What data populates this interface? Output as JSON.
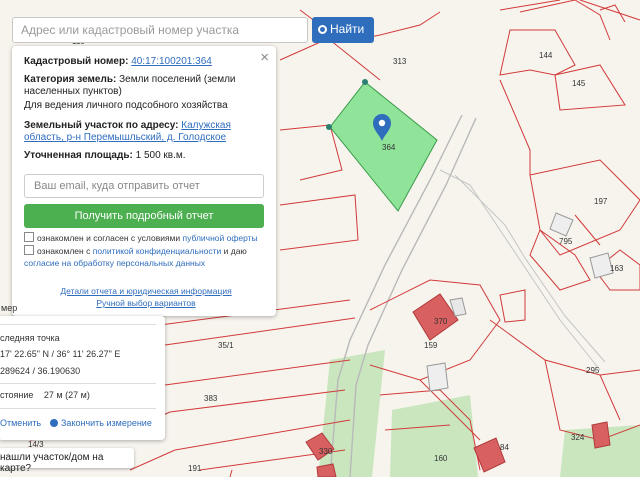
{
  "search": {
    "placeholder": "Адрес или кадастровый номер участка",
    "button_label": "Найти"
  },
  "panel": {
    "cad_label": "Кадастровый номер:",
    "cad_value": "40:17:100201:364",
    "category_label": "Категория земель:",
    "category_value": "Земли поселений (земли населенных пунктов)",
    "usage": "Для ведения личного подсобного хозяйства",
    "address_label": "Земельный участок по адресу:",
    "address_value": "Калужская область, р-н Перемышльский, д. Голодское",
    "area_label": "Уточненная площадь:",
    "area_value": "1 500 кв.м.",
    "email_placeholder": "Ваш email, куда отправить отчет",
    "get_report": "Получить подробный отчет",
    "consent1_prefix": "ознакомлен и согласен с условиями",
    "consent1_link": "публичной оферты",
    "consent2_prefix": "ознакомлен с",
    "consent2_link": "политикой конфиденциальности",
    "consent2_mid": "и даю",
    "consent2_link2": "согласие на обработку персональных данных",
    "details_link": "Детали отчета и юридическая информация",
    "manual_link": "Ручной выбор вариантов"
  },
  "measure": {
    "partial_title": "мер",
    "last_point_label": "следняя точка",
    "coords_dms": "17' 22.65\" N / 36° 11' 26.27\" E",
    "coords_dec": "289624 / 36.190630",
    "distance_label": "стояние",
    "distance_value": "27 м (27 м)",
    "cancel": "Отменить",
    "finish": "Закончить измерение"
  },
  "map_question": "нашли участок/дом на карте?",
  "map": {
    "highlight_color": "#7ee08a",
    "parcel_line_color": "#d23a3a",
    "building_color": "#d96060",
    "forest_color": "#c9e6bf",
    "pin_color": "#2f6dbd",
    "labels": [
      "313",
      "144",
      "145",
      "364",
      "197",
      "795",
      "163",
      "370",
      "159",
      "295",
      "324",
      "35/1",
      "383",
      "191",
      "160",
      "14/3",
      "330",
      "84",
      "110"
    ]
  }
}
